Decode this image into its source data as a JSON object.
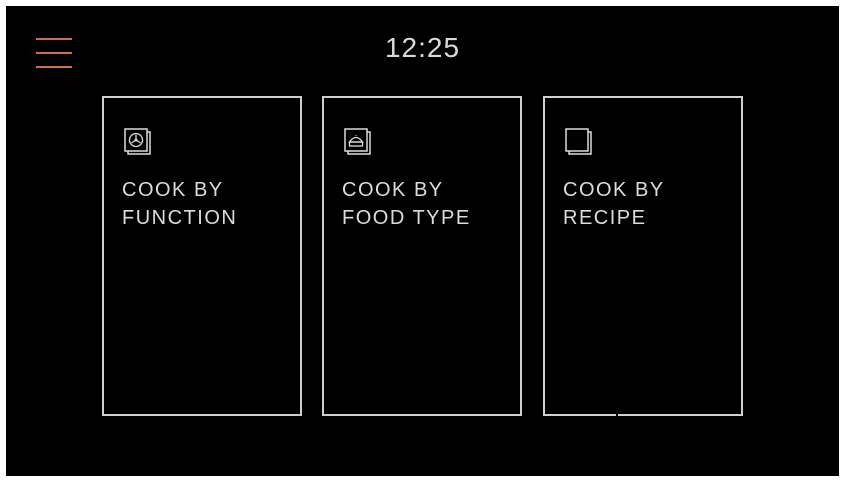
{
  "header": {
    "time": "12:25",
    "menu_icon": "hamburger-menu-icon",
    "menu_color": "#d26b4f"
  },
  "cards": [
    {
      "line1": "COOK BY",
      "line2": "FUNCTION",
      "icon": "fan-function-icon"
    },
    {
      "line1": "COOK BY",
      "line2": "FOOD TYPE",
      "icon": "food-type-icon"
    },
    {
      "line1": "COOK BY",
      "line2": "RECIPE",
      "icon": "recipe-book-icon"
    }
  ],
  "colors": {
    "background": "#000000",
    "border": "#cfcfcf",
    "text": "#d9d9d9"
  }
}
